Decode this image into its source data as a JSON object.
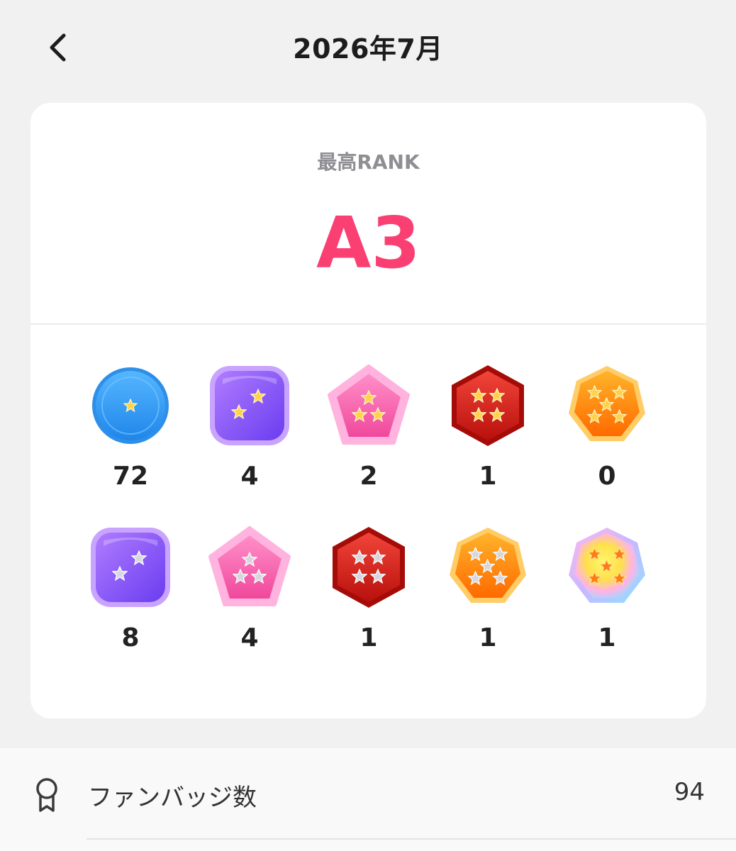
{
  "header": {
    "title": "2026年7月",
    "back_icon": "chevron-left-icon"
  },
  "rank": {
    "label": "最高RANK",
    "value": "A3",
    "value_color": "#fa3f73"
  },
  "badges": {
    "row1": [
      {
        "icon": "blue-circle-1star-badge-icon",
        "count": "72"
      },
      {
        "icon": "purple-square-2star-badge-icon",
        "count": "4"
      },
      {
        "icon": "pink-pentagon-3star-badge-icon",
        "count": "2"
      },
      {
        "icon": "red-hexagon-4star-badge-icon",
        "count": "1"
      },
      {
        "icon": "orange-heptagon-5star-badge-icon",
        "count": "0"
      }
    ],
    "row2": [
      {
        "icon": "purple-square-2silverstar-badge-icon",
        "count": "8"
      },
      {
        "icon": "pink-pentagon-3silverstar-badge-icon",
        "count": "4"
      },
      {
        "icon": "red-hexagon-4silverstar-badge-icon",
        "count": "1"
      },
      {
        "icon": "orange-heptagon-5silverstar-badge-icon",
        "count": "1"
      },
      {
        "icon": "rainbow-heptagon-5star-badge-icon",
        "count": "1"
      }
    ]
  },
  "list": {
    "fan_badges": {
      "icon": "ribbon-award-icon",
      "label": "ファンバッジ数",
      "value": "94"
    }
  }
}
